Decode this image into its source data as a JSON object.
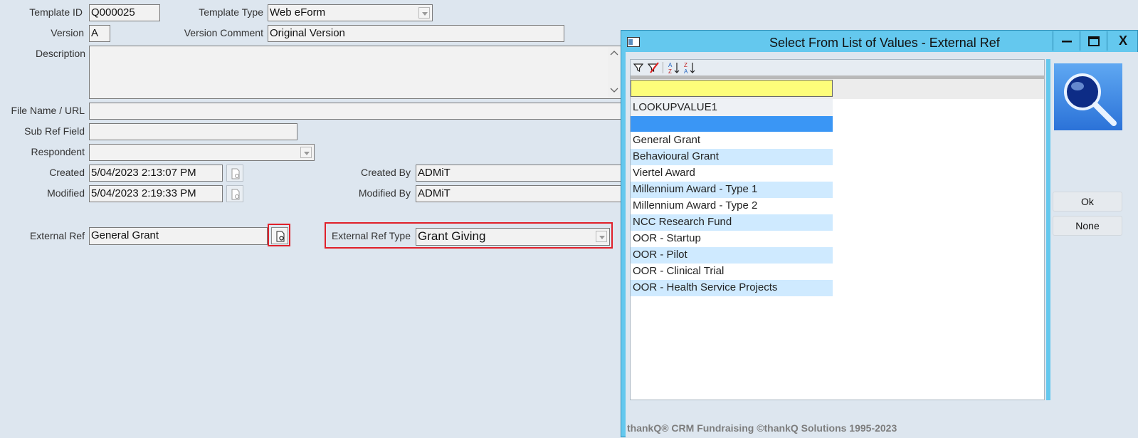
{
  "form": {
    "template_id_label": "Template ID",
    "template_id": "Q000025",
    "template_type_label": "Template Type",
    "template_type": "Web eForm",
    "version_label": "Version",
    "version": "A",
    "version_comment_label": "Version Comment",
    "version_comment": "Original Version",
    "description_label": "Description",
    "description": "",
    "file_name_label": "File Name / URL",
    "file_name": "",
    "sub_ref_label": "Sub Ref Field",
    "sub_ref": "",
    "respondent_label": "Respondent",
    "respondent": "",
    "created_label": "Created",
    "created": "5/04/2023 2:13:07 PM",
    "created_by_label": "Created By",
    "created_by": "ADMiT",
    "modified_label": "Modified",
    "modified": "5/04/2023 2:19:33 PM",
    "modified_by_label": "Modified By",
    "modified_by": "ADMiT",
    "external_ref_label": "External Ref",
    "external_ref": "General Grant",
    "external_ref_type_label": "External Ref Type",
    "external_ref_type": "Grant Giving"
  },
  "dialog": {
    "title": "Select From List of Values - External Ref",
    "window_buttons": {
      "minimize": "minimize-icon",
      "maximize": "maximize-icon",
      "close": "X"
    },
    "toolbar_icons": [
      "filter-icon",
      "clear-filter-icon",
      "sort-ascending-icon",
      "sort-descending-icon"
    ],
    "filter_value": "",
    "column_header": "LOOKUPVALUE1",
    "selected_value": "",
    "rows": [
      "General Grant",
      "Behavioural Grant",
      "Viertel Award",
      "Millennium Award - Type 1",
      "Millennium Award - Type 2",
      "NCC Research Fund",
      "OOR - Startup",
      "OOR - Pilot",
      "OOR - Clinical Trial",
      "OOR - Health Service Projects"
    ],
    "ok_label": "Ok",
    "none_label": "None",
    "footer": "thankQ® CRM Fundraising ©thankQ Solutions 1995-2023"
  },
  "colors": {
    "background": "#dde6ef",
    "dialog_frame": "#64c8ee",
    "selected_row": "#3a96f5",
    "alt_row": "#cfeaff",
    "filter_row": "#fdfd7a",
    "highlight_box": "#e0202a"
  }
}
